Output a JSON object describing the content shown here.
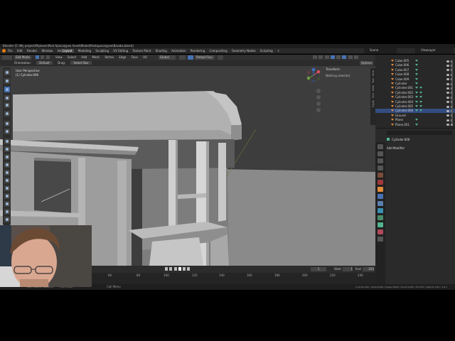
{
  "app": {
    "title_bar": "Blender [C:\\My project\\Mylosev\\Post Apocalypse Asset\\Model\\Postapocalypse\\Baraka.blend]",
    "menus": [
      "File",
      "Edit",
      "Render",
      "Window",
      "Help"
    ],
    "workspaces": [
      "Layout",
      "Modeling",
      "Sculpting",
      "UV Editing",
      "Texture Paint",
      "Shading",
      "Animation",
      "Rendering",
      "Compositing",
      "Geometry Nodes",
      "Scripting",
      "+"
    ],
    "active_workspace": "Layout",
    "scene": "Scene",
    "view_layer": "ViewLayer"
  },
  "viewport_header": {
    "mode": "Edit Mode",
    "items": [
      "View",
      "Select",
      "Add",
      "Mesh",
      "Vertex",
      "Edge",
      "Face",
      "UV"
    ],
    "transform": "Global",
    "snap": "Retopt Flux"
  },
  "tool_options": {
    "orientation_label": "Orientation:",
    "orientation_value": "Default",
    "drag_label": "Drag:",
    "drag_value": "Select Box",
    "options": "Options"
  },
  "viewport": {
    "view_name": "User Perspective",
    "object_info": "(1) Cylinder.006",
    "transform_panel_title": "Transform",
    "nothing_selected": "Nothing selected",
    "npanel_tabs": [
      "Item",
      "Tool",
      "View",
      "Edit",
      "Rigify"
    ]
  },
  "timeline": {
    "start_label": "Start",
    "start": "1",
    "end_label": "End",
    "end": "250",
    "current": "1",
    "ticks": [
      "60",
      "80",
      "100",
      "120",
      "140",
      "160",
      "180",
      "200",
      "220",
      "240"
    ]
  },
  "statusbar": {
    "left": "Set Active Modifier",
    "middle": "Pan View",
    "context": "Call Menu",
    "right": "Cylinder.006 | Verts:0/408 | Edges:0/808 | Faces:0/408 | Tris:876 | Objects:1/25 | 3.6.1"
  },
  "outliner": {
    "rows": [
      {
        "name": "Cube.005",
        "mods": 1
      },
      {
        "name": "Cube.006",
        "mods": 1
      },
      {
        "name": "Cube.007",
        "mods": 1
      },
      {
        "name": "Cube.008",
        "mods": 1
      },
      {
        "name": "Cube.009",
        "mods": 1
      },
      {
        "name": "Cylinder",
        "mods": 1
      },
      {
        "name": "Cylinder.001",
        "mods": 2
      },
      {
        "name": "Cylinder.002",
        "mods": 2
      },
      {
        "name": "Cylinder.003",
        "mods": 2
      },
      {
        "name": "Cylinder.004",
        "mods": 2
      },
      {
        "name": "Cylinder.005",
        "mods": 2
      },
      {
        "name": "Cylinder.006",
        "mods": 2,
        "selected": true
      },
      {
        "name": "Ground",
        "mods": 0
      },
      {
        "name": "Plane",
        "mods": 1
      },
      {
        "name": "Plane.001",
        "mods": 1
      }
    ]
  },
  "properties": {
    "object_name": "Cylinder.006",
    "add_modifier": "Add Modifier"
  },
  "colors": {
    "accent_blue": "#4772b3",
    "selection_row": "#334d80",
    "object_orange": "#e38b3a",
    "modifier_teal": "#52b38d",
    "viewport_bg": "#3d3d3d"
  },
  "icons": [
    "cursor-icon",
    "move-icon",
    "rotate-icon",
    "scale-icon",
    "annotate-icon",
    "measure-icon",
    "extrude-icon",
    "inset-icon",
    "bevel-icon",
    "loopcut-icon",
    "knife-icon",
    "polybuild-icon",
    "spin-icon",
    "smooth-icon",
    "edge-slide-icon",
    "shrink-icon",
    "shear-icon",
    "rip-icon",
    "zoom-icon",
    "hand-icon",
    "camera-icon",
    "grid-icon",
    "wrench-icon",
    "object-icon",
    "scene-icon",
    "world-icon",
    "render-icon",
    "output-icon",
    "physics-icon",
    "constraint-icon",
    "data-icon",
    "material-icon"
  ]
}
